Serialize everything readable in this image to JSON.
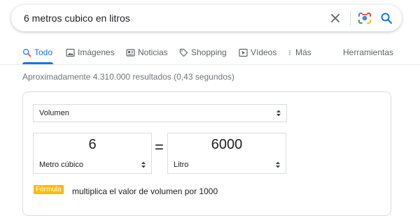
{
  "search": {
    "query": "6 metros cubico en litros"
  },
  "tabs": [
    {
      "label": "Todo",
      "icon": "search-icon",
      "active": true
    },
    {
      "label": "Imágenes",
      "icon": "image-icon"
    },
    {
      "label": "Noticias",
      "icon": "news-icon"
    },
    {
      "label": "Shopping",
      "icon": "tag-icon"
    },
    {
      "label": "Vídeos",
      "icon": "play-icon"
    },
    {
      "label": "Más",
      "icon": "more-vert-icon"
    },
    {
      "label": "Herramientas"
    }
  ],
  "results": {
    "stats": "Aproximadamente 4.310.000 resultados (0,43 segundos)"
  },
  "converter": {
    "category": "Volumen",
    "from": {
      "value": "6",
      "unit": "Metro cúbico"
    },
    "equals": "=",
    "to": {
      "value": "6000",
      "unit": "Litro"
    },
    "formula_label": "Fórmula",
    "formula_text": "multiplica el valor de volumen por 1000"
  },
  "colors": {
    "accent": "#1a73e8",
    "formula_badge": "#fbbc04",
    "border": "#dadce0"
  }
}
